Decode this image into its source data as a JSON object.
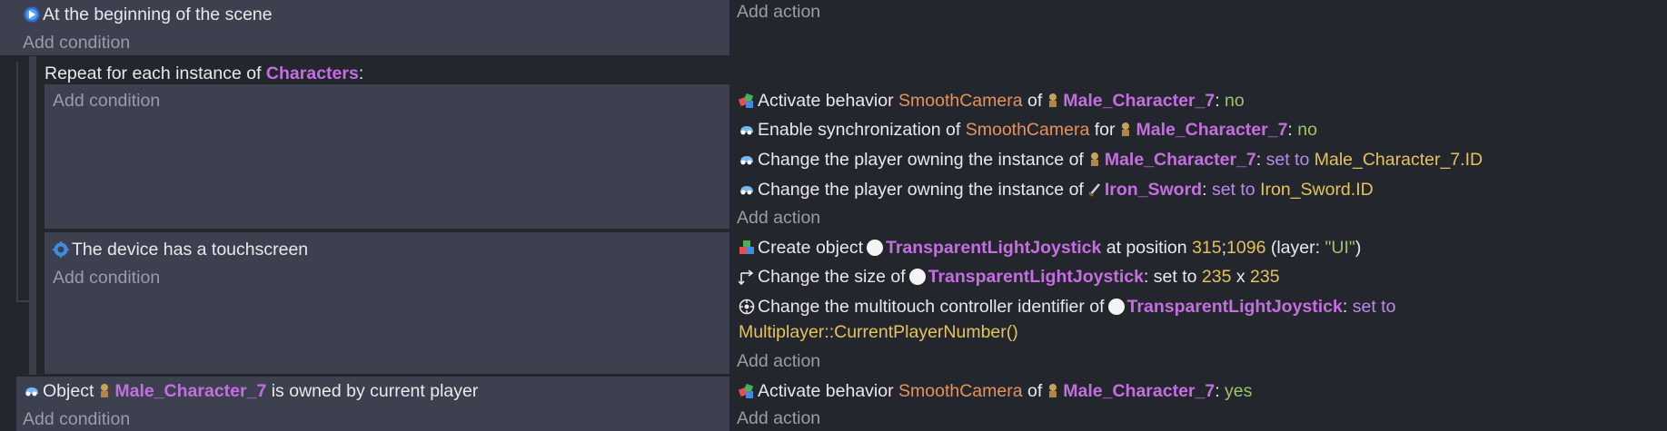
{
  "event1": {
    "condition": "At the beginning of the scene",
    "add_condition": "Add condition",
    "add_action": "Add action"
  },
  "event2": {
    "repeat_prefix": "Repeat for each instance of",
    "repeat_object": "Characters",
    "repeat_suffix": ":",
    "add_condition": "Add condition",
    "add_action": "Add action",
    "actions": [
      {
        "p1": "Activate behavior",
        "behavior": "SmoothCamera",
        "p2": "of",
        "object": "Male_Character_7",
        "p3": ":",
        "value": "no"
      },
      {
        "p1": "Enable synchronization of",
        "behavior": "SmoothCamera",
        "p2": "for",
        "object": "Male_Character_7",
        "p3": ":",
        "value": "no"
      },
      {
        "p1": "Change the player owning the instance of",
        "object": "Male_Character_7",
        "p3": ":",
        "op": "set to",
        "value": "Male_Character_7.ID"
      },
      {
        "p1": "Change the player owning the instance of",
        "object": "Iron_Sword",
        "p3": ":",
        "op": "set to",
        "value": "Iron_Sword.ID"
      }
    ]
  },
  "event3": {
    "condition": "The device has a touchscreen",
    "add_condition": "Add condition",
    "add_action": "Add action",
    "actions": [
      {
        "p1": "Create object",
        "object": "TransparentLightJoystick",
        "p2": "at position",
        "x": "315",
        "sep": ";",
        "y": "1096",
        "p3": "(layer:",
        "layer": "\"UI\"",
        "p4": ")"
      },
      {
        "p1": "Change the size of",
        "object": "TransparentLightJoystick",
        "p2": ": set to",
        "w": "235",
        "sep": "x",
        "h": "235"
      },
      {
        "p1": "Change the multitouch controller identifier of",
        "object": "TransparentLightJoystick",
        "p2": ":",
        "op": "set to",
        "value": "Multiplayer::CurrentPlayerNumber()"
      }
    ]
  },
  "event4": {
    "p1": "Object",
    "object": "Male_Character_7",
    "p2": "is owned by current player",
    "add_condition": "Add condition",
    "add_action": "Add action",
    "action": {
      "p1": "Activate behavior",
      "behavior": "SmoothCamera",
      "p2": "of",
      "object": "Male_Character_7",
      "p3": ":",
      "value": "yes"
    }
  },
  "icons": {
    "scene_start": "scene-start-icon",
    "behavior": "behavior-icon",
    "multiplayer": "multiplayer-icon",
    "character": "character-sprite-icon",
    "sword": "sword-sprite-icon",
    "touch": "gear-touch-icon",
    "create": "create-object-icon",
    "resize": "resize-icon",
    "joystick": "joystick-target-icon"
  },
  "colors": {
    "background": "#24262e",
    "panel": "#3d404e",
    "object": "#c46ee0",
    "behavior": "#e6935a",
    "keyword": "#b98ae6",
    "number": "#e6c25a",
    "value": "#9bc46a",
    "muted": "#9a9ca6"
  }
}
